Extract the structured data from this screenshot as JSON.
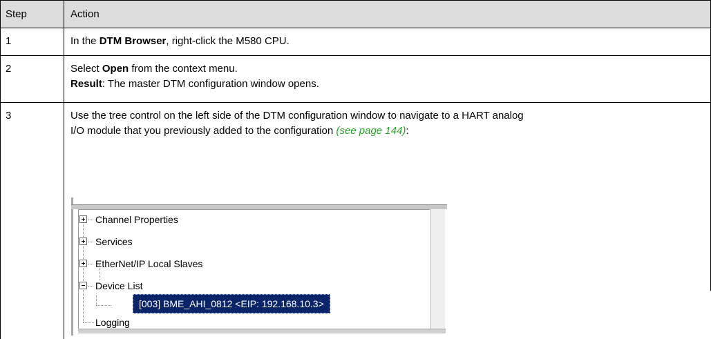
{
  "table": {
    "header": {
      "step": "Step",
      "action": "Action"
    },
    "rows": [
      {
        "step": "1",
        "line1_pre": "In the ",
        "line1_bold": "DTM Browser",
        "line1_post": ", right-click the M580 CPU."
      },
      {
        "step": "2",
        "line1_pre": "Select ",
        "line1_bold": "Open",
        "line1_post": " from the context menu.",
        "line2_bold": "Result",
        "line2_post": ": The master DTM configuration window opens."
      },
      {
        "step": "3",
        "line1": "Use the tree control on the left side of the DTM configuration window to navigate to a HART analog",
        "line2_pre": "I/O module that you previously added to the configuration ",
        "line2_link": "(see page 144)",
        "line2_post": ":"
      }
    ]
  },
  "tree": {
    "items": [
      {
        "label": "Channel Properties",
        "expander": "plus"
      },
      {
        "label": "Services",
        "expander": "plus"
      },
      {
        "label": "EtherNet/IP Local Slaves",
        "expander": "plus"
      },
      {
        "label": "Device List",
        "expander": "minus"
      },
      {
        "label": "[003] BME_AHI_0812 <EIP: 192.168.10.3>",
        "selected": true
      },
      {
        "label": "Logging",
        "expander": "none"
      }
    ]
  },
  "colors": {
    "header_bg": "#dcdcdc",
    "link": "#2aa12a",
    "selection": "#0a246a"
  }
}
